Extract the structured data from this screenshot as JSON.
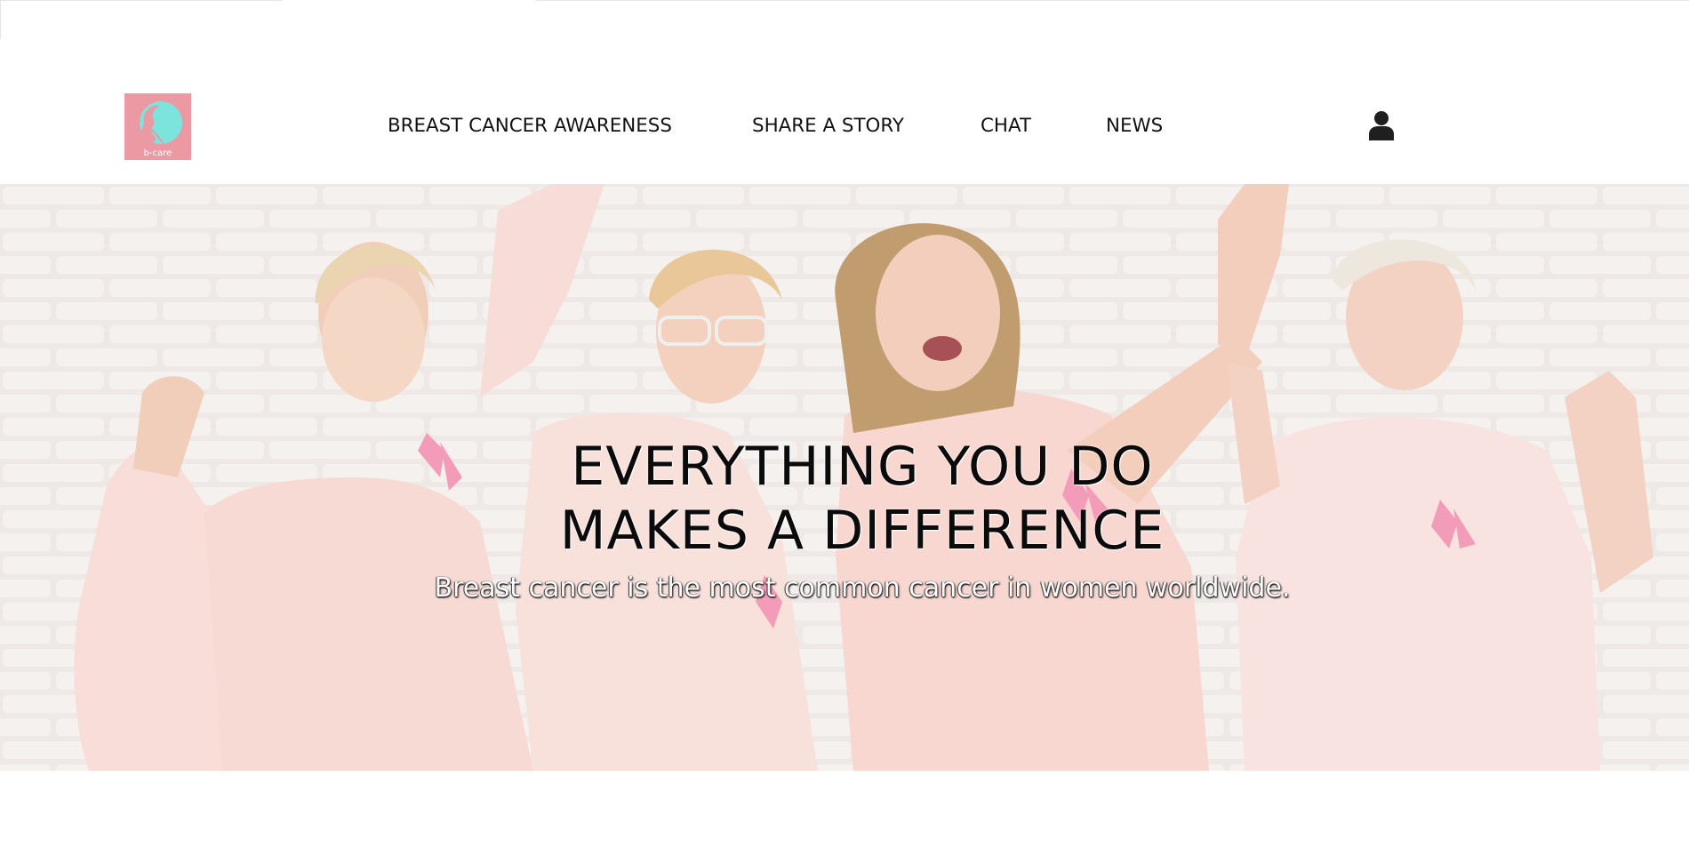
{
  "header": {
    "logo_text": "b-care",
    "nav": [
      {
        "label": "BREAST CANCER AWARENESS"
      },
      {
        "label": "SHARE A STORY"
      },
      {
        "label": "CHAT"
      },
      {
        "label": "NEWS"
      }
    ],
    "user_icon": "user-icon"
  },
  "hero": {
    "title_line1": "EVERYTHING YOU DO",
    "title_line2": "MAKES A DIFFERENCE",
    "subtitle": "Breast cancer is the most common cancer in women worldwide."
  },
  "colors": {
    "logo_bg": "#eb9aa4",
    "logo_head": "#7de3dd",
    "ribbon": "#f28fb0",
    "shirt": "#f6d5cf",
    "wall": "#ece4e1"
  }
}
